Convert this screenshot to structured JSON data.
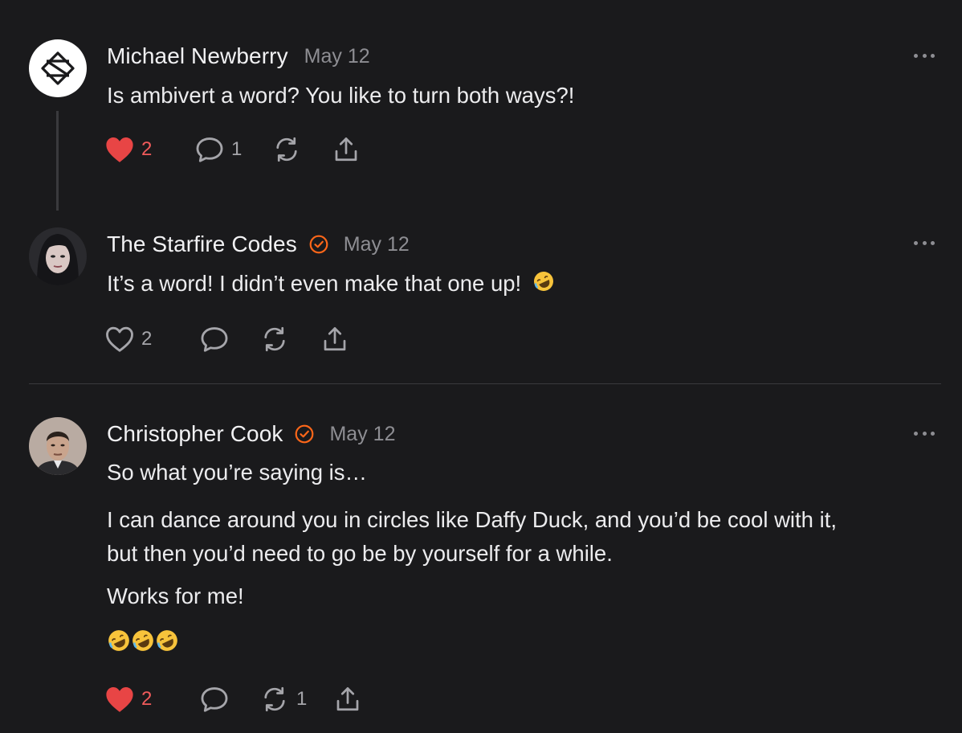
{
  "colors": {
    "background": "#1a1a1c",
    "text": "#ececee",
    "muted": "#8e8e93",
    "like_active": "#e84545",
    "verified": "#ff6719"
  },
  "comments": [
    {
      "author": "Michael Newberry",
      "date": "May 12",
      "verified": false,
      "text": [
        "Is ambivert a word? You like to turn both ways?!"
      ],
      "likes": "2",
      "liked": true,
      "replies": "1",
      "restacks": ""
    },
    {
      "author": "The Starfire Codes",
      "date": "May 12",
      "verified": true,
      "text": [
        "It’s a word! I didn’t even make that one up!"
      ],
      "likes": "2",
      "liked": false,
      "replies": "",
      "restacks": ""
    },
    {
      "author": "Christopher Cook",
      "date": "May 12",
      "verified": true,
      "text": [
        "So what you’re saying is…",
        "I can dance around you in circles like Daffy Duck, and you’d be cool with it,",
        "but then you’d need to go be by yourself for a while.",
        "Works for me!"
      ],
      "likes": "2",
      "liked": true,
      "replies": "",
      "restacks": "1"
    }
  ],
  "icons": {
    "avatar_logo": "substack-diamond-logo-icon",
    "more": "more-horizontal-icon",
    "like": "heart-icon",
    "reply": "comment-bubble-icon",
    "restack": "restack-arrows-icon",
    "share": "share-upload-icon",
    "verified": "check-circle-icon",
    "emoji": "rolling-on-floor-laughing-emoji"
  }
}
